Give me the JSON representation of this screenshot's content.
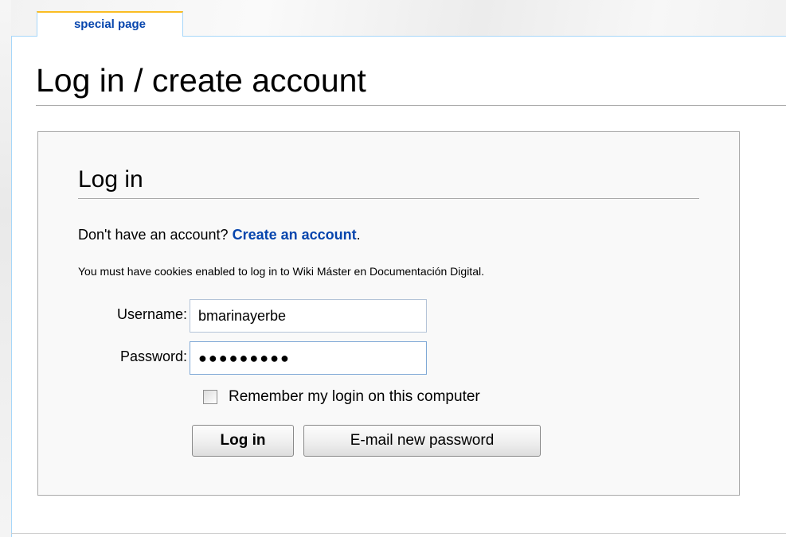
{
  "tab": {
    "label": "special page"
  },
  "page": {
    "title": "Log in / create account"
  },
  "login_box": {
    "heading": "Log in",
    "no_account_text": "Don't have an account?",
    "create_account_link": "Create an account",
    "period": ".",
    "cookies_note": "You must have cookies enabled to log in to Wiki Máster en Documentación Digital."
  },
  "form": {
    "username_label": "Username:",
    "username_value": "bmarinayerbe",
    "password_label": "Password:",
    "password_value": "●●●●●●●●●",
    "remember_checked": false,
    "remember_label": "Remember my login on this computer",
    "login_button": "Log in",
    "email_button": "E-mail new password"
  },
  "colors": {
    "link": "#0645ad",
    "tab_accent": "#fabd23",
    "box_background": "#f9f9f9"
  }
}
